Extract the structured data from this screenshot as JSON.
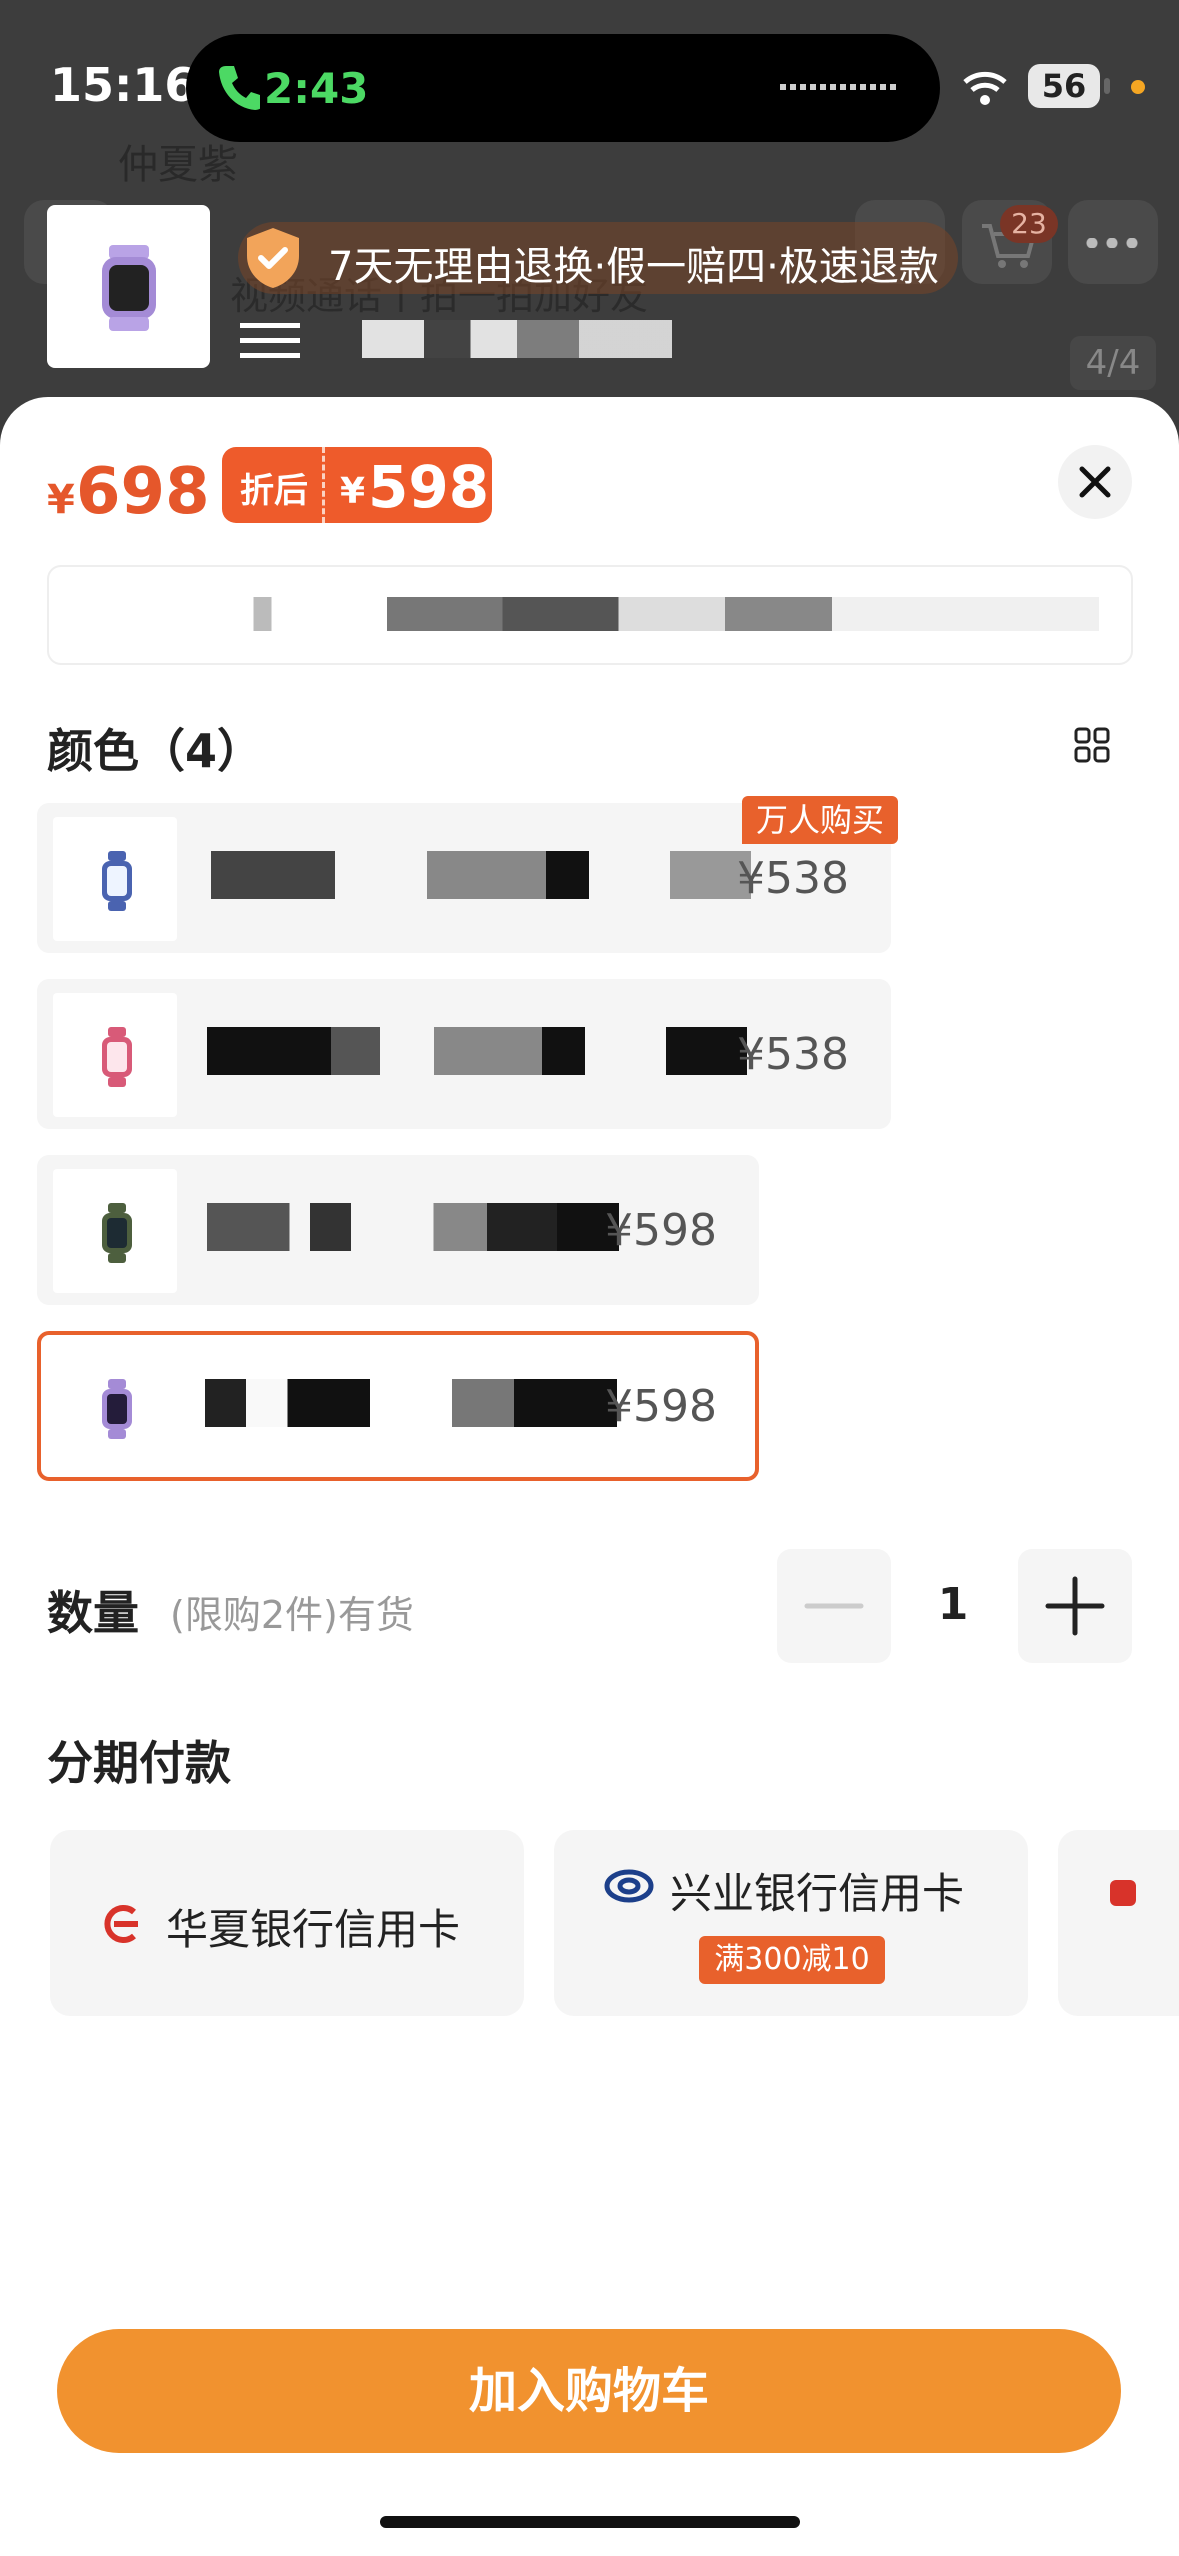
{
  "status_bar": {
    "time": "15:16",
    "call_time": "2:43",
    "battery": "56"
  },
  "background": {
    "shop_title": "仲夏紫",
    "product_subtitle": "视频通话丨拍一拍加好友",
    "cart_count": "23",
    "image_pager": "4/4",
    "guarantee": "7天无理由退换·假一赔四·极速退款"
  },
  "sheet": {
    "currency": "¥",
    "price": "698",
    "after_label": "折后",
    "after_price": "598",
    "color_title": "颜色（4）",
    "hot_tag": "万人购买",
    "variants": [
      {
        "price": "¥538",
        "watch_color": "#4a63b0"
      },
      {
        "price": "¥538",
        "watch_color": "#d85a78"
      },
      {
        "price": "¥598",
        "watch_color": "#4d5f3e"
      },
      {
        "price": "¥598",
        "watch_color": "#a48bd6",
        "selected": true
      }
    ],
    "quantity_label": "数量",
    "quantity_note": "(限购2件)有货",
    "quantity": "1",
    "installment_title": "分期付款",
    "banks": [
      {
        "name": "华夏银行信用卡",
        "icon": "huaxia-bank-icon"
      },
      {
        "name": "兴业银行信用卡",
        "icon": "industrial-bank-icon",
        "promo": "满300减10"
      }
    ],
    "add_to_cart": "加入购物车"
  },
  "colors": {
    "accent": "#e8612c",
    "cta": "#f1922f",
    "price": "#e5572b"
  }
}
